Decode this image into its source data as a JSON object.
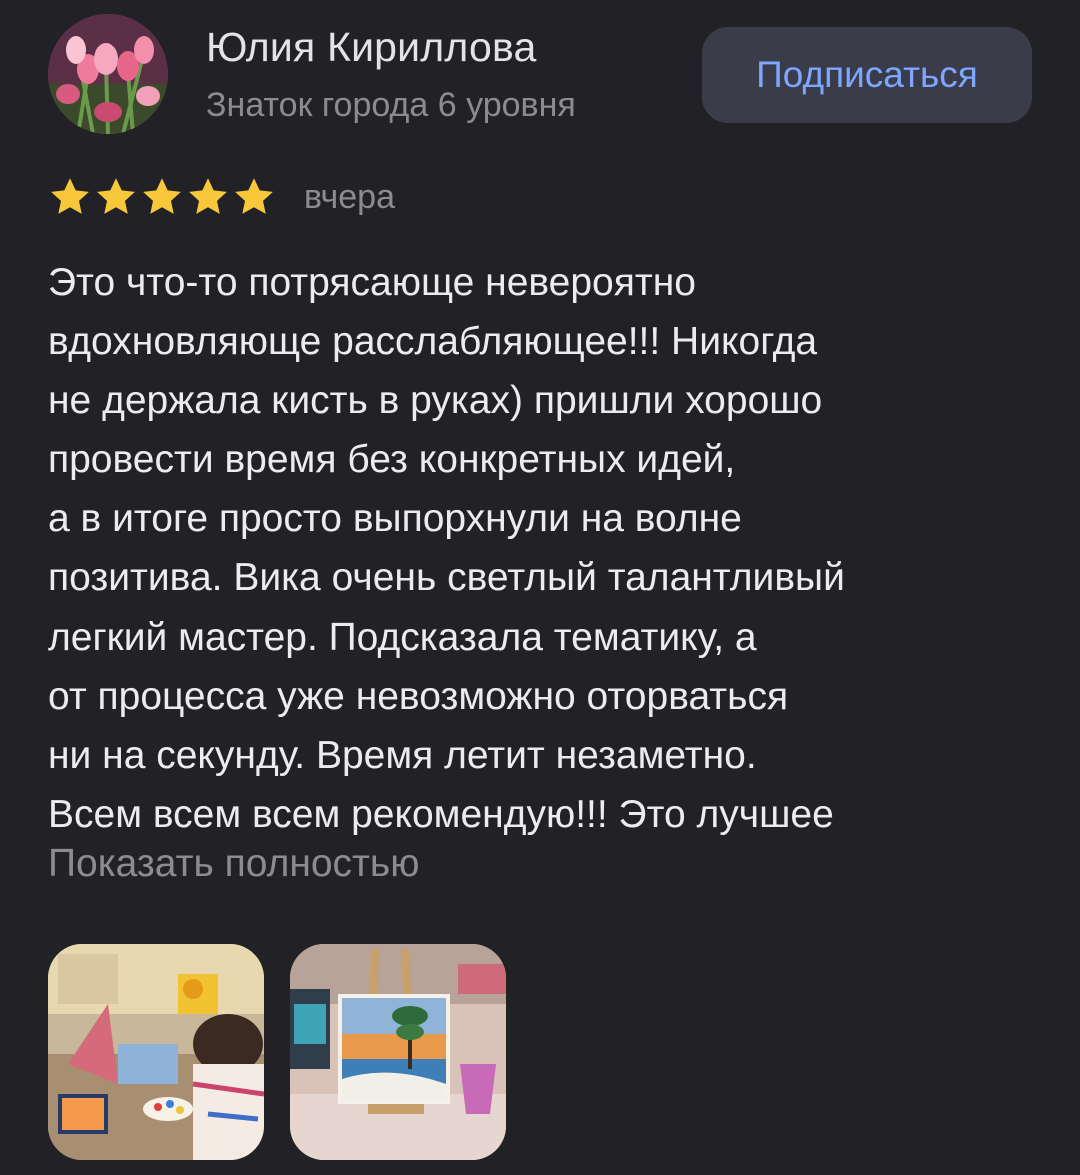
{
  "author": {
    "name": "Юлия Кириллова",
    "level": "Знаток города 6 уровня",
    "avatar_icon": "avatar-tulips"
  },
  "subscribe_label": "Подписаться",
  "rating": {
    "stars": 5,
    "max": 5,
    "date": "вчера"
  },
  "review_lines": [
    "Это что-то потрясающе невероятно",
    "вдохновляюще расслабляющее!!! Никогда",
    "не держала кисть в руках) пришли хорошо",
    "провести время без конкретных идей,",
    "а в итоге просто выпорхнули на волне",
    "позитива. Вика очень светлый талантливый",
    "легкий мастер. Подсказала тематику,  а",
    "от процесса уже невозможно оторваться",
    "ни на секунду. Время летит незаметно.",
    "Всем всем всем рекомендую!!! Это лучшее"
  ],
  "show_more_label": "Показать полностью",
  "photos": [
    {
      "icon": "photo-painting-class"
    },
    {
      "icon": "photo-easel-painting"
    }
  ],
  "colors": {
    "background": "#222226",
    "accent": "#7ea6ff",
    "star": "#f8c83a",
    "button_bg": "#3a3d49"
  }
}
